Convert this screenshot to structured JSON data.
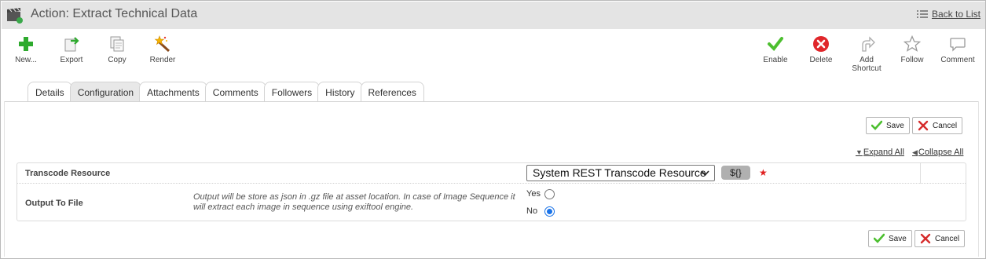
{
  "header": {
    "title": "Action: Extract Technical Data",
    "back_link": "Back to List"
  },
  "toolbar": {
    "left": [
      {
        "label": "New...",
        "icon": "plus-icon"
      },
      {
        "label": "Export",
        "icon": "export-icon"
      },
      {
        "label": "Copy",
        "icon": "copy-icon"
      },
      {
        "label": "Render",
        "icon": "magic-wand-icon"
      }
    ],
    "right": [
      {
        "label": "Enable",
        "icon": "checkmark-icon"
      },
      {
        "label": "Delete",
        "icon": "delete-icon"
      },
      {
        "label": "Add\nShortcut",
        "icon": "shortcut-icon"
      },
      {
        "label": "Follow",
        "icon": "star-icon"
      },
      {
        "label": "Comment",
        "icon": "comment-icon"
      }
    ]
  },
  "tabs": [
    {
      "label": "Details",
      "active": false
    },
    {
      "label": "Configuration",
      "active": true
    },
    {
      "label": "Attachments",
      "active": false
    },
    {
      "label": "Comments",
      "active": false
    },
    {
      "label": "Followers",
      "active": false
    },
    {
      "label": "History",
      "active": false
    },
    {
      "label": "References",
      "active": false
    }
  ],
  "buttons": {
    "save": "Save",
    "cancel": "Cancel"
  },
  "expand": {
    "expand_all": "Expand All",
    "collapse_all": "Collapse All"
  },
  "form": {
    "transcode": {
      "label": "Transcode Resource",
      "value": "System REST Transcode Resource",
      "var_button": "${}",
      "required_mark": "★"
    },
    "output": {
      "label": "Output To File",
      "help": "Output will be store as json in .gz file at asset location. In case of Image Sequence it will extract each image in sequence using exiftool engine.",
      "options": [
        {
          "label": "Yes",
          "checked": false
        },
        {
          "label": "No",
          "checked": true
        }
      ]
    }
  },
  "colors": {
    "green": "#2eaa2e",
    "red": "#d62b2b",
    "radio_blue": "#1a73e8"
  }
}
